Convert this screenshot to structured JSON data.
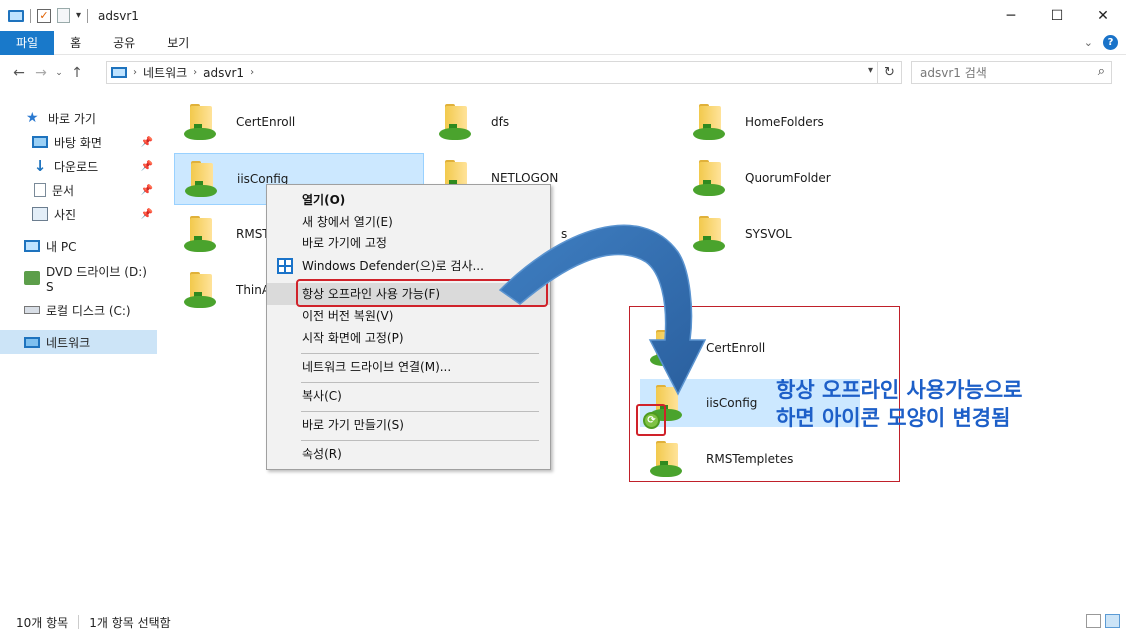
{
  "window": {
    "title": "adsvr1",
    "controls": [
      "─",
      "☐",
      "✕"
    ]
  },
  "ribbon": {
    "tabs": [
      "파일",
      "홈",
      "공유",
      "보기"
    ]
  },
  "address": {
    "crumbs": [
      "네트워크",
      "adsvr1"
    ],
    "search_placeholder": "adsvr1 검색"
  },
  "sidebar": {
    "items": [
      {
        "label": "바로 가기",
        "icon": "star-icon",
        "pinned": false
      },
      {
        "label": "바탕 화면",
        "icon": "desktop-icon",
        "pinned": true
      },
      {
        "label": "다운로드",
        "icon": "download-icon",
        "pinned": true
      },
      {
        "label": "문서",
        "icon": "document-icon",
        "pinned": true
      },
      {
        "label": "사진",
        "icon": "pictures-icon",
        "pinned": true
      },
      {
        "label": "내 PC",
        "icon": "pc-icon",
        "pinned": false
      },
      {
        "label": "DVD 드라이브 (D:) S",
        "icon": "dvd-icon",
        "pinned": false
      },
      {
        "label": "로컬 디스크 (C:)",
        "icon": "drive-icon",
        "pinned": false
      },
      {
        "label": "네트워크",
        "icon": "network-icon",
        "pinned": false,
        "selected": true
      }
    ]
  },
  "files": [
    {
      "name": "CertEnroll"
    },
    {
      "name": "dfs"
    },
    {
      "name": "HomeFolders"
    },
    {
      "name": "iisConfig",
      "selected": true
    },
    {
      "name": "NETLOGON"
    },
    {
      "name": "QuorumFolder"
    },
    {
      "name": "RMSTe"
    },
    {
      "name": "s"
    },
    {
      "name": "SYSVOL"
    },
    {
      "name": "ThinAp"
    }
  ],
  "context_menu": {
    "items": [
      "열기(O)",
      "새 창에서 열기(E)",
      "바로 가기에 고정",
      "Windows Defender(으)로 검사...",
      "항상 오프라인 사용 가능(F)",
      "이전 버전 복원(V)",
      "시작 화면에 고정(P)",
      "네트워크 드라이브 연결(M)...",
      "복사(C)",
      "바로 가기 만들기(S)",
      "속성(R)"
    ]
  },
  "annotation": {
    "folders": [
      "CertEnroll",
      "iisConfig",
      "RMSTempletes"
    ],
    "note_line1": "항상 오프라인 사용가능으로",
    "note_line2": "하면 아이콘 모양이 변경됨",
    "note_color": "#1d5fc8",
    "highlight_color": "#d0222a"
  },
  "status": {
    "count": "10개 항목",
    "selection": "1개 항목 선택함"
  },
  "colors": {
    "accent": "#1979ca",
    "selection": "#cce8ff"
  }
}
